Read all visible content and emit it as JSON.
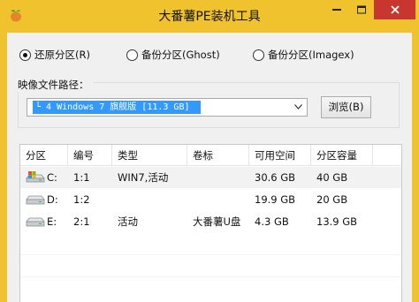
{
  "window": {
    "title": "大番薯PE装机工具",
    "accent": "#f0c22e",
    "close_color": "#c7372f"
  },
  "modes": [
    {
      "label": "还原分区(R)",
      "checked": true
    },
    {
      "label": "备份分区(Ghost)",
      "checked": false
    },
    {
      "label": "备份分区(Imagex)",
      "checked": false
    }
  ],
  "image_path": {
    "group_label": "映像文件路径：",
    "selected_value": "└ 4 Windows 7 旗舰版 [11.3 GB]",
    "browse_label": "浏览(B)"
  },
  "table": {
    "columns": [
      "分区",
      "编号",
      "类型",
      "卷标",
      "可用空间",
      "分区容量"
    ],
    "rows": [
      {
        "drive": "C:",
        "number": "1:1",
        "type": "WIN7,活动",
        "label": "",
        "free": "30.6 GB",
        "capacity": "40 GB",
        "icon": "windows-drive-icon",
        "selected": true
      },
      {
        "drive": "D:",
        "number": "1:2",
        "type": "",
        "label": "",
        "free": "19.9 GB",
        "capacity": "20 GB",
        "icon": "drive-icon",
        "selected": false
      },
      {
        "drive": "E:",
        "number": "2:1",
        "type": "活动",
        "label": "大番薯U盘",
        "free": "4.3 GB",
        "capacity": "13.9 GB",
        "icon": "drive-icon",
        "selected": false
      }
    ]
  }
}
